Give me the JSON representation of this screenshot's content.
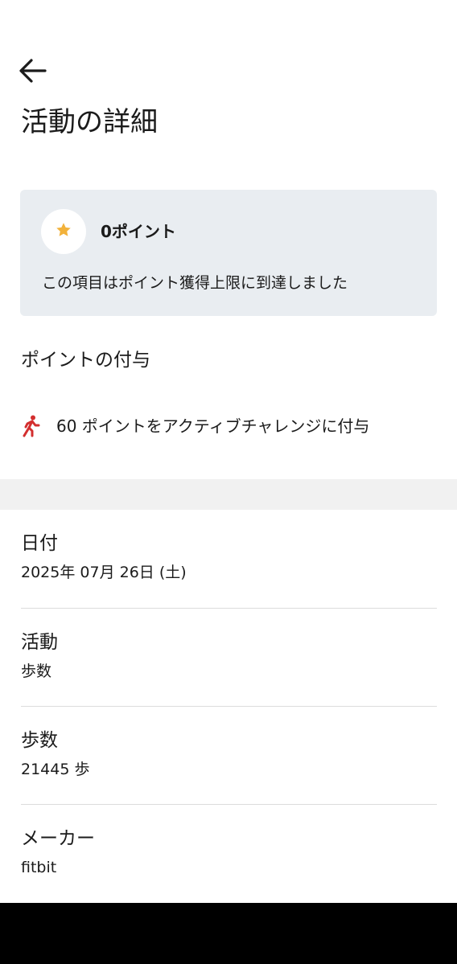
{
  "header": {
    "back_icon": "arrow-left-icon",
    "title": "活動の詳細"
  },
  "points_card": {
    "icon": "star-icon",
    "star_color": "#f2b23b",
    "points_label": "0ポイント",
    "note": "この項目はポイント獲得上限に到達しました"
  },
  "award_section": {
    "heading": "ポイントの付与",
    "icon": "walking-person-icon",
    "icon_color": "#d32f2f",
    "text": "60 ポイントをアクティブチャレンジに付与"
  },
  "details": [
    {
      "label": "日付",
      "value": "2025年 07月 26日 (土)"
    },
    {
      "label": "活動",
      "value": "歩数"
    },
    {
      "label": "歩数",
      "value": "21445 歩"
    },
    {
      "label": "メーカー",
      "value": "fitbit"
    }
  ]
}
